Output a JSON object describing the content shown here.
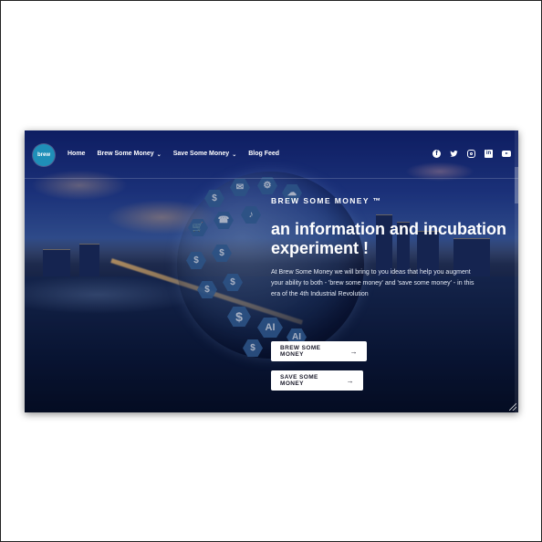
{
  "nav": {
    "logo_text": "brew",
    "items": [
      {
        "label": "Home",
        "has_dropdown": false
      },
      {
        "label": "Brew Some Money",
        "has_dropdown": true
      },
      {
        "label": "Save Some Money",
        "has_dropdown": true
      },
      {
        "label": "Blog Feed",
        "has_dropdown": false
      }
    ],
    "social": [
      {
        "name": "facebook-icon",
        "glyph": "f"
      },
      {
        "name": "twitter-icon",
        "glyph": "🐦"
      },
      {
        "name": "instagram-icon",
        "glyph": ""
      },
      {
        "name": "linkedin-icon",
        "glyph": "in"
      },
      {
        "name": "youtube-icon",
        "glyph": ""
      }
    ]
  },
  "hero": {
    "eyebrow": "BREW SOME MONEY ™",
    "headline": "an information and incubation experiment !",
    "description": "At Brew Some Money we will bring to you ideas that help you augment your ability to both - 'brew some money' and 'save some money' - in this era of the 4th Industrial Revolution",
    "buttons": [
      {
        "label": "BREW SOME MONEY",
        "arrow": "→"
      },
      {
        "label": "SAVE SOME MONEY",
        "arrow": "→"
      }
    ]
  },
  "globe": {
    "tiles": [
      "$",
      "AI",
      "✉",
      "$",
      "⚙",
      "☁",
      "$",
      "♪",
      "AI",
      "$",
      "🛒",
      "☎"
    ]
  },
  "colors": {
    "accent": "#1f8fb8",
    "sky_top": "#13257a",
    "button_bg": "#ffffff",
    "text": "#ffffff"
  }
}
